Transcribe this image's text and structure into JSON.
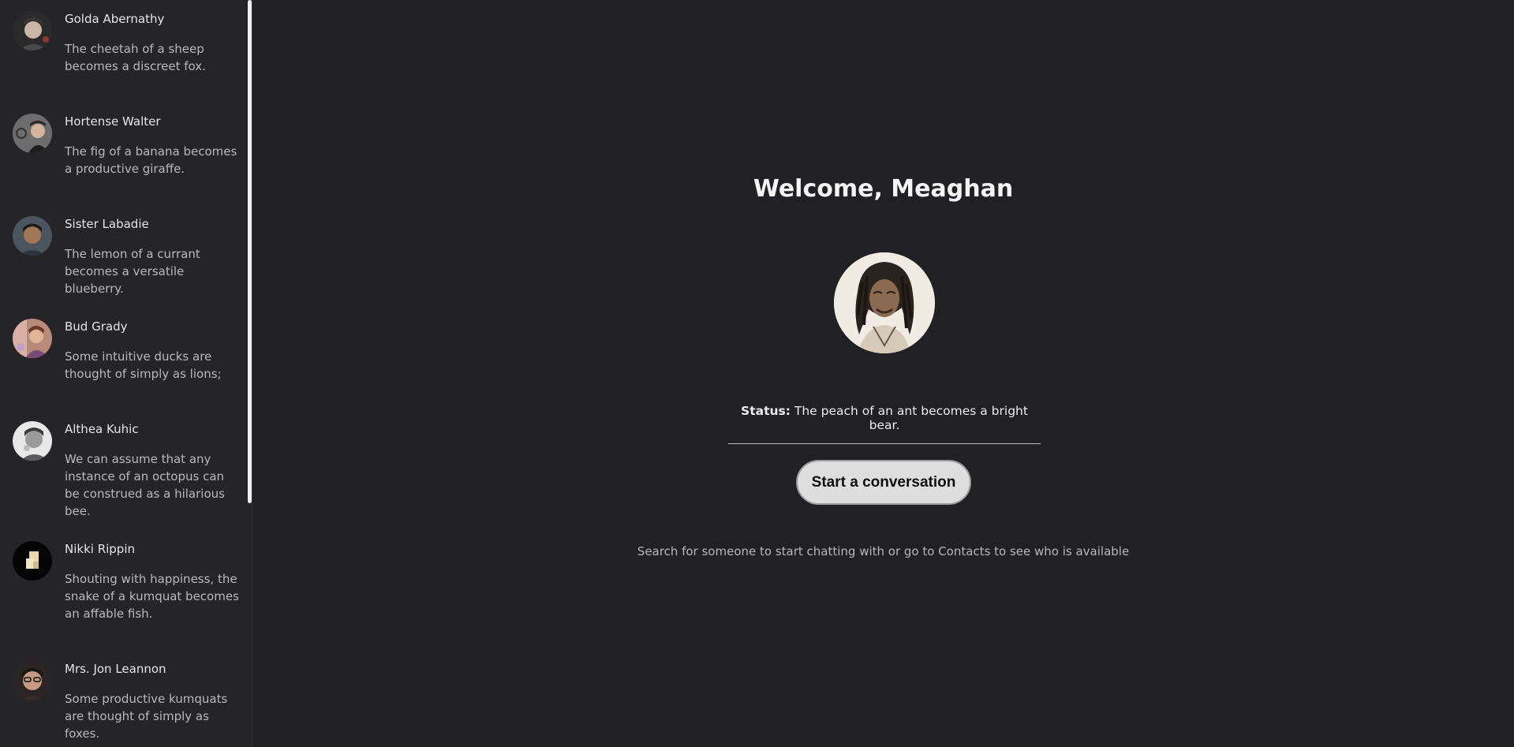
{
  "contacts": [
    {
      "name": "Golda Abernathy",
      "message": "The cheetah of a sheep becomes a discreet fox."
    },
    {
      "name": "Hortense Walter",
      "message": "The fig of a banana becomes a productive giraffe."
    },
    {
      "name": "Sister Labadie",
      "message": "The lemon of a currant becomes a versatile blueberry."
    },
    {
      "name": "Bud Grady",
      "message": "Some intuitive ducks are thought of simply as lions;"
    },
    {
      "name": "Althea Kuhic",
      "message": "We can assume that any instance of an octopus can be construed as a hilarious bee."
    },
    {
      "name": "Nikki Rippin",
      "message": "Shouting with happiness, the snake of a kumquat becomes an affable fish."
    },
    {
      "name": "Mrs. Jon Leannon",
      "message": "Some productive kumquats are thought of simply as foxes."
    }
  ],
  "main": {
    "welcome": "Welcome, Meaghan",
    "status_label": "Status:",
    "status_text": "The peach of an ant becomes a bright bear.",
    "start_button": "Start a conversation",
    "hint": "Search for someone to start chatting with or go to Contacts to see who is available"
  },
  "colors": {
    "background": "#212124",
    "sidebar": "#252528",
    "button": "#dedede"
  }
}
